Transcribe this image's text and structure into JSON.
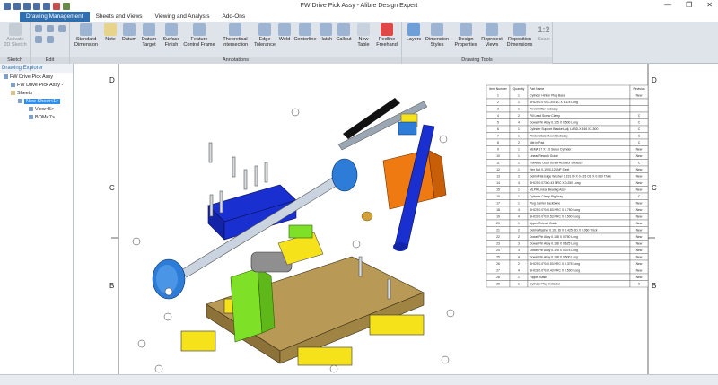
{
  "window": {
    "title": "FW Drive Pick Assy - Alibre Design Expert"
  },
  "tabs": [
    {
      "label": "Drawing Management"
    },
    {
      "label": "Sheets and Views"
    },
    {
      "label": "Viewing and Analysis"
    },
    {
      "label": "Add-Ons"
    }
  ],
  "ribbon": {
    "groups": {
      "sketch": "Sketch",
      "edit": "Edit",
      "annotations": "Annotations",
      "drawing_tools": "Drawing Tools"
    },
    "buttons": {
      "activate_2d": "Activate 2D Sketch",
      "standard_dimension": "Standard Dimension",
      "note": "Note",
      "datum": "Datum",
      "datum_target": "Datum Target",
      "surface_finish": "Surface Finish",
      "feature_control_frame": "Feature Control Frame",
      "theoretical_intersection": "Theoretical Intersection",
      "edge_tolerance": "Edge Tolerance",
      "weld": "Weld",
      "centerline": "Centerline",
      "hatch": "Hatch",
      "callout": "Callout",
      "new_table": "New Table",
      "redline_freehand": "Redline Freehand",
      "layers": "Layers",
      "dimension_styles": "Dimension Styles",
      "design_properties": "Design Properties",
      "reproject_views": "Reproject Views",
      "reposition_dimensions": "Reposition Dimensions",
      "scale": "Scale",
      "scale_value": "1:2"
    }
  },
  "explorer": {
    "header": "Drawing Explorer",
    "items": [
      {
        "label": "FW Drive Pick Assy"
      },
      {
        "label": "FW Drive Pick Assy -"
      },
      {
        "label": "Sheets"
      },
      {
        "label": "New Sheet<1>"
      },
      {
        "label": "View<5>"
      },
      {
        "label": "BOM<7>"
      }
    ]
  },
  "drawing": {
    "border_letters_left": [
      "D",
      "C",
      "B"
    ],
    "border_letters_right": [
      "D",
      "C",
      "B"
    ]
  },
  "bom": {
    "headers": [
      "Item Number",
      "Quantity",
      "Part Name",
      "Revision"
    ],
    "rows": [
      [
        "1",
        "1",
        "Cylinder Hinton Plug Base",
        "New"
      ],
      [
        "2",
        "1",
        "SHCS 0.0°0x1-3/4 NC X 1-1/4 Long",
        ""
      ],
      [
        "3",
        "1",
        "Pivot Drifter Subassy",
        ""
      ],
      [
        "4",
        "2",
        "Pill Lead Screw Clamp",
        "C"
      ],
      [
        "5",
        "4",
        "Dowel Pin Alloy 0.125 X 0.500 Long",
        "C"
      ],
      [
        "6",
        "1",
        "Cylinder Support Bracket Adj. LABD-X 346 XX-500",
        "C"
      ],
      [
        "7",
        "1",
        "Photovoltaic Mount Subassy",
        "C"
      ],
      [
        "8",
        "2",
        "Idle In Pad",
        "C"
      ],
      [
        "9",
        "1",
        "NEMA 17 X 1.5 Servo Cylinder",
        "New"
      ],
      [
        "10",
        "1",
        "Linear Rework Guide",
        "New"
      ],
      [
        "11",
        "2",
        "Traverse Lead Screw Actuator Subassy",
        "C"
      ],
      [
        "12",
        "1",
        "Hex Nut 0-1900-12UNF Steel",
        "New"
      ],
      [
        "13",
        "2",
        "Delrin Flat Edge Washer 0.191 ID X 0.425 OD X 0.060 Thick",
        "New"
      ],
      [
        "14",
        "4",
        "SHCS 0.073x0.43 NRC X 0.250 Long",
        "New"
      ],
      [
        "15",
        "1",
        "MLPR Linear Bearing Assy",
        "New"
      ],
      [
        "16",
        "1",
        "Cylinder Clamp Pig Assy",
        "C"
      ],
      [
        "17",
        "1",
        "Plug Carrier Backbone",
        "New"
      ],
      [
        "18",
        "4",
        "SHCS 0.0°0x0.83 NRC X 0.750 Long",
        "New"
      ],
      [
        "19",
        "4",
        "SHCS 0.0°0x0.53 NRC X 0.500 Long",
        "New"
      ],
      [
        "20",
        "1",
        "Upper Retract Guide",
        "New"
      ],
      [
        "21",
        "2",
        "Delrin Washer 0.191 ID X 0.425 OD X 0.060 Thick",
        "New"
      ],
      [
        "22",
        "2",
        "Dowel Pin Alloy 0.188 X 0.750 Long",
        "New"
      ],
      [
        "23",
        "3",
        "Dowel Pin Alloy 0.188 X 0.625 Long",
        "New"
      ],
      [
        "24",
        "3",
        "Dowel Pin Alloy 0.125 X 0.375 Long",
        "New"
      ],
      [
        "25",
        "4",
        "Dowel Pin Alloy 0.188 X 0.500 Long",
        "New"
      ],
      [
        "26",
        "2",
        "SHCS 0.0°0x0.53 NRC X 0.375 Long",
        "New"
      ],
      [
        "27",
        "4",
        "SHCS 0.0°0x0.43 NRC X 0.500 Long",
        "New"
      ],
      [
        "28",
        "1",
        "Flipper Base",
        "New"
      ],
      [
        "29",
        "1",
        "Cylinder Plug Indicator",
        "C"
      ]
    ]
  },
  "colors": {
    "tab_active": "#2f6faf",
    "ribbon_bg": "#dfe4ea",
    "part_blue": "#1a2fd0",
    "part_tan": "#b89a56",
    "part_green": "#7fe028",
    "part_yellow": "#f5e21a",
    "part_orange": "#f07a12"
  }
}
